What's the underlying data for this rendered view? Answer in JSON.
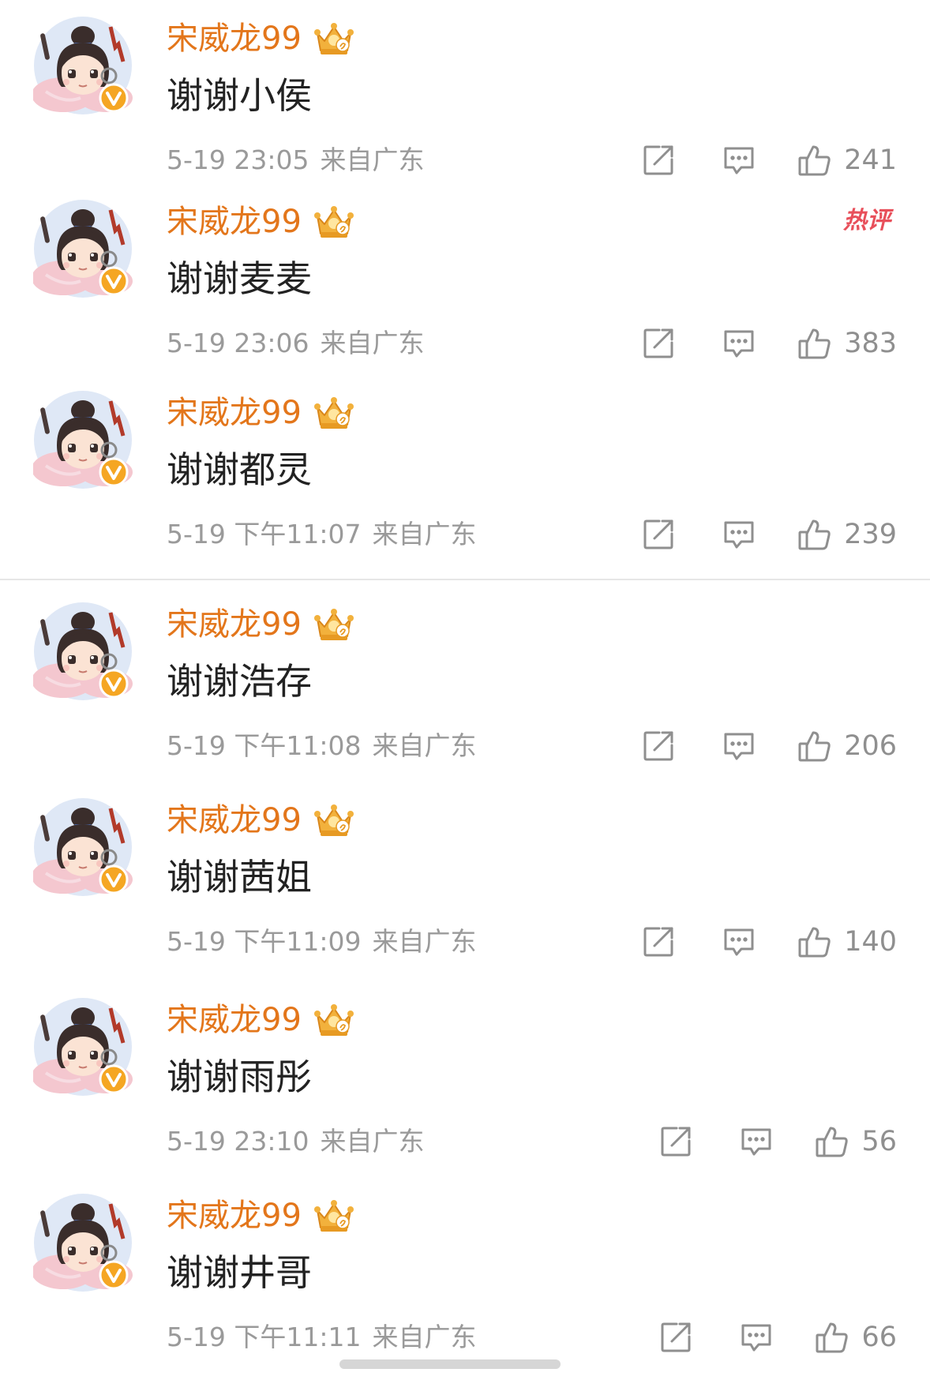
{
  "colors": {
    "username": "#e3761b",
    "comment_text": "#222222",
    "meta_text": "#9a9a9a",
    "hot_badge": "#e8505b",
    "verified_badge": "#f08c1c"
  },
  "icons": {
    "share": "share-icon",
    "comment": "comment-icon",
    "like": "thumbs-up-icon",
    "verified": "verified-v-icon",
    "crown": "crown-icon"
  },
  "comments": [
    {
      "username": "宋威龙99",
      "text": "谢谢小侯",
      "time": "5-19 23:05",
      "location": "来自广东",
      "likes": "241",
      "hot": ""
    },
    {
      "username": "宋威龙99",
      "text": "谢谢麦麦",
      "time": "5-19 23:06",
      "location": "来自广东",
      "likes": "383",
      "hot": "热评"
    },
    {
      "username": "宋威龙99",
      "text": "谢谢都灵",
      "time": "5-19 下午11:07",
      "location": "来自广东",
      "likes": "239",
      "hot": ""
    },
    {
      "username": "宋威龙99",
      "text": "谢谢浩存",
      "time": "5-19 下午11:08",
      "location": "来自广东",
      "likes": "206",
      "hot": ""
    },
    {
      "username": "宋威龙99",
      "text": "谢谢茜姐",
      "time": "5-19 下午11:09",
      "location": "来自广东",
      "likes": "140",
      "hot": ""
    },
    {
      "username": "宋威龙99",
      "text": "谢谢雨彤",
      "time": "5-19 23:10",
      "location": "来自广东",
      "likes": "56",
      "hot": ""
    },
    {
      "username": "宋威龙99",
      "text": "谢谢井哥",
      "time": "5-19 下午11:11",
      "location": "来自广东",
      "likes": "66",
      "hot": ""
    }
  ]
}
